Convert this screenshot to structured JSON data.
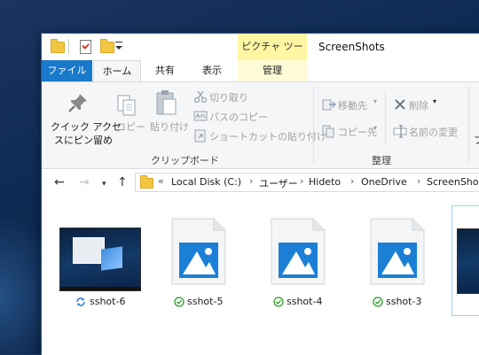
{
  "quick_access": {
    "folder_icon": "folder-icon",
    "properties_icon": "properties-icon",
    "new_folder_icon": "new-folder-icon",
    "customize_icon": "customize-dropdown-icon"
  },
  "title_bar": {
    "context_tab_header": "ピクチャ ツール",
    "window_title": "ScreenShots"
  },
  "tabs": [
    {
      "label": "ファイル",
      "active": false
    },
    {
      "label": "ホーム",
      "active": true
    },
    {
      "label": "共有",
      "active": false
    },
    {
      "label": "表示",
      "active": false
    },
    {
      "label": "管理",
      "active": false
    }
  ],
  "ribbon": {
    "clipboard": {
      "pin_label_line1": "クイック アクセ",
      "pin_label_line2": "スにピン留め",
      "copy_label": "コピー",
      "paste_label": "貼り付け",
      "cut_label": "切り取り",
      "copy_path_label": "パスのコピー",
      "paste_shortcut_label": "ショートカットの貼り付け",
      "group_label": "クリップボード"
    },
    "organize": {
      "move_to_label": "移動先",
      "copy_to_label": "コピー先",
      "delete_label": "削除",
      "rename_label": "名前の変更",
      "group_label": "整理"
    },
    "new_partial_label": "フ"
  },
  "navigation": {
    "back_icon": "back-arrow-icon",
    "forward_icon": "forward-arrow-icon",
    "recent_icon": "recent-dropdown-icon",
    "up_icon": "up-arrow-icon"
  },
  "address_bar": {
    "overflow": "«",
    "crumbs": [
      "Local Disk (C:)",
      "ユーザー",
      "Hideto",
      "OneDrive",
      "ScreenShot"
    ],
    "separator": "›"
  },
  "files": [
    {
      "name": "sshot-6",
      "status": "syncing",
      "thumbnail": "screenshot-thumbnail"
    },
    {
      "name": "sshot-5",
      "status": "synced",
      "thumbnail": "image-file-icon"
    },
    {
      "name": "sshot-4",
      "status": "synced",
      "thumbnail": "image-file-icon"
    },
    {
      "name": "sshot-3",
      "status": "synced",
      "thumbnail": "image-file-icon"
    }
  ],
  "colors": {
    "file_tab": "#1979ca",
    "context_tab": "#fdf6a3",
    "image_icon_blue": "#1c7fd6",
    "synced_green": "#2a9d2a",
    "syncing_blue": "#1e73c8",
    "desktop": "#0d2a52"
  }
}
